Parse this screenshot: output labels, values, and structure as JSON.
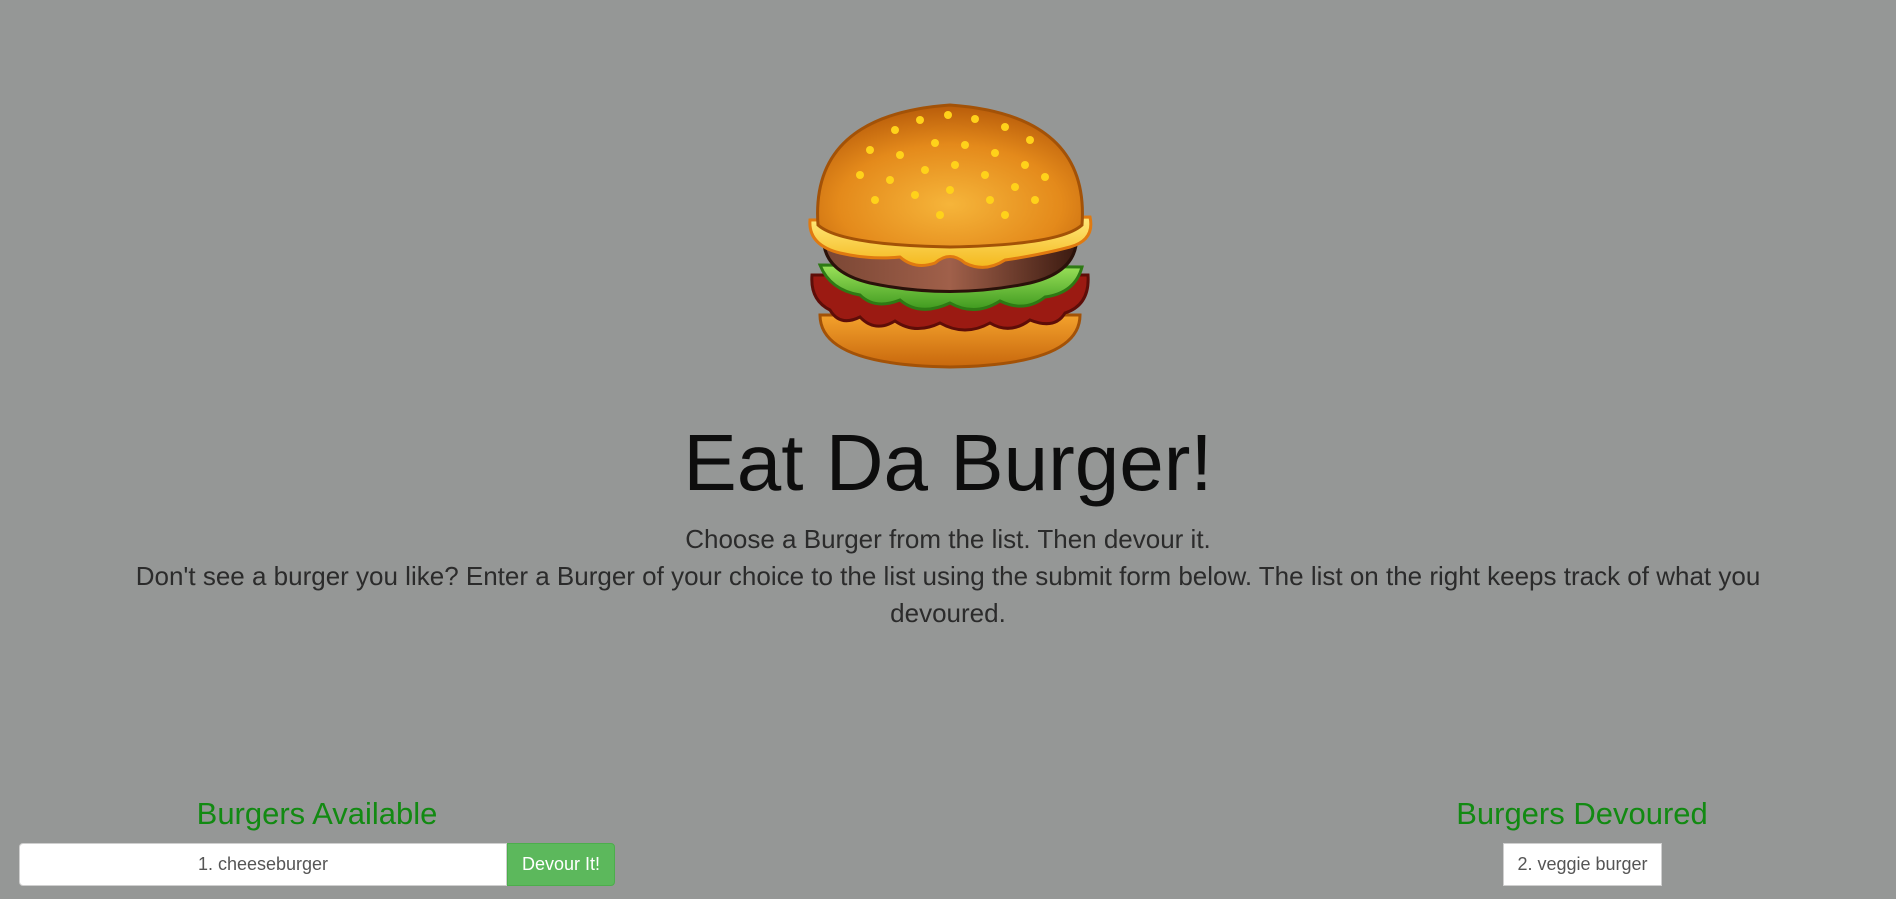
{
  "header": {
    "title": "Eat Da Burger!",
    "subtitle_line1": "Choose a Burger from the list. Then devour it.",
    "subtitle_line2": "Don't see a burger you like? Enter a Burger of your choice to the list using the submit form below. The list on the right keeps track of what you devoured.",
    "image_icon": "hamburger-icon"
  },
  "available": {
    "heading": "Burgers Available",
    "items": [
      {
        "label": "1. cheeseburger",
        "button_label": "Devour It!"
      }
    ]
  },
  "devoured": {
    "heading": "Burgers Devoured",
    "items": [
      {
        "label": "2. veggie burger"
      }
    ]
  },
  "colors": {
    "background": "#959796",
    "heading_green": "#128a12",
    "button_green": "#5cb85c"
  }
}
